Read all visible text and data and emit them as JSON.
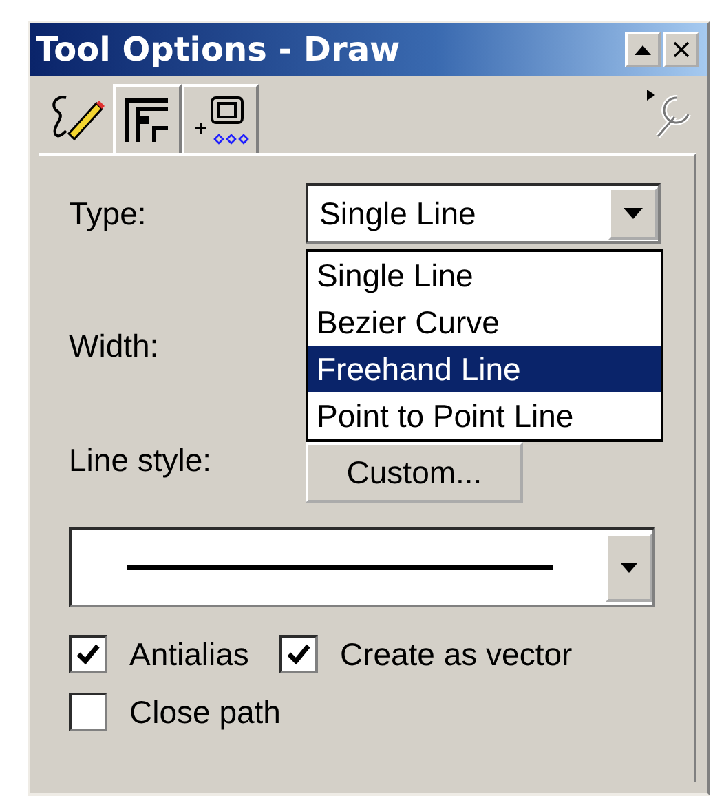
{
  "window": {
    "title": "Tool Options - Draw"
  },
  "tabs": [
    {
      "selected": true
    },
    {
      "selected": false
    },
    {
      "selected": false
    }
  ],
  "type": {
    "label": "Type:",
    "value": "Single Line",
    "options": [
      {
        "label": "Single Line",
        "highlighted": false
      },
      {
        "label": "Bezier Curve",
        "highlighted": false
      },
      {
        "label": "Freehand Line",
        "highlighted": true
      },
      {
        "label": "Point to Point Line",
        "highlighted": false
      }
    ]
  },
  "width": {
    "label": "Width:"
  },
  "line_style": {
    "label": "Line style:",
    "button": "Custom..."
  },
  "checkboxes": [
    {
      "label": "Antialias",
      "checked": true
    },
    {
      "label": "Create as vector",
      "checked": true
    },
    {
      "label": "Close path",
      "checked": false
    }
  ]
}
